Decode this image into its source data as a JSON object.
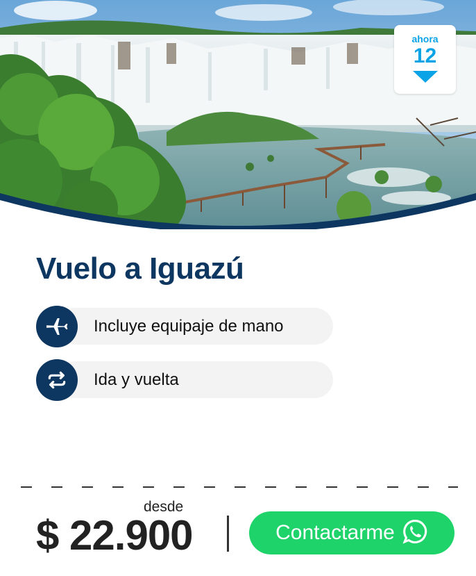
{
  "hero": {
    "image": "iguazu-waterfalls-photo"
  },
  "badge": {
    "top": "ahora",
    "number": "12",
    "icon": "down-arrow-icon"
  },
  "card": {
    "title": "Vuelo a Iguazú",
    "features": [
      {
        "icon": "airplane-icon",
        "label": "Incluye equipaje de mano"
      },
      {
        "icon": "round-trip-icon",
        "label": "Ida y vuelta"
      }
    ]
  },
  "pricing": {
    "prefix": "desde",
    "price": "$ 22.900"
  },
  "cta": {
    "label": "Contactarme",
    "icon": "whatsapp-icon"
  },
  "colors": {
    "navy": "#0d3660",
    "green": "#1ed36a",
    "badge_blue": "#0aa3e6"
  }
}
